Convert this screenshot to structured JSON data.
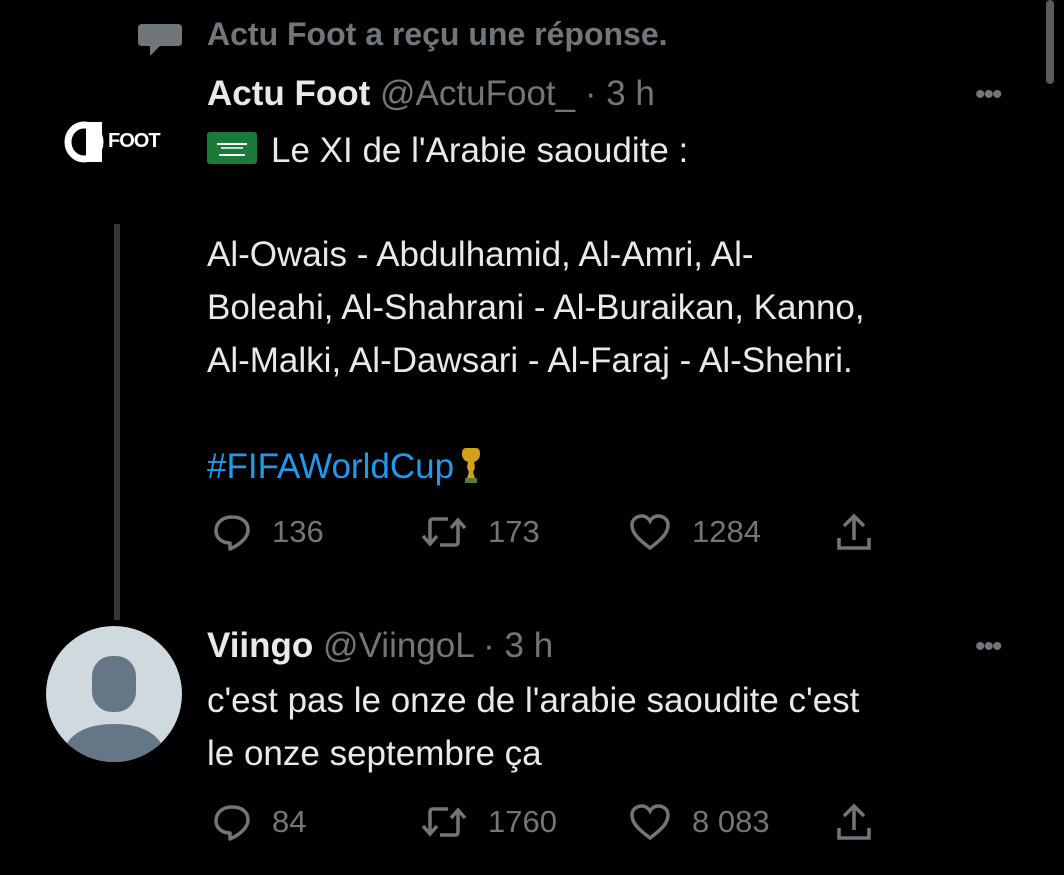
{
  "context": {
    "text": "Actu Foot a reçu une réponse."
  },
  "tweet1": {
    "name": "Actu Foot",
    "handle": "@ActuFoot_",
    "time": "· 3 h",
    "avatar_text": "FOOT",
    "flag_icon": "saudi-arabia-flag",
    "line1": "Le XI de l'Arabie saoudite :",
    "lines": [
      "Al-Owais - Abdulhamid, Al-Amri, Al-",
      "Boleahi, Al-Shahrani - Al-Buraikan, Kanno,",
      "Al-Malki, Al-Dawsari - Al-Faraj - Al-Shehri."
    ],
    "hashtag": "#FIFAWorldCup",
    "trophy_icon": "trophy-icon",
    "replies": "136",
    "retweets": "173",
    "likes": "1284"
  },
  "tweet2": {
    "name": "Viingo",
    "handle": "@ViingoL",
    "time": "· 3 h",
    "lines": [
      "c'est pas le onze de l'arabie saoudite c'est",
      "le onze septembre ça"
    ],
    "replies": "84",
    "retweets": "1760",
    "likes": "8 083"
  },
  "colors": {
    "background": "#000000",
    "text": "#e7e9ea",
    "muted": "#71767b",
    "link": "#1d9bf0"
  }
}
